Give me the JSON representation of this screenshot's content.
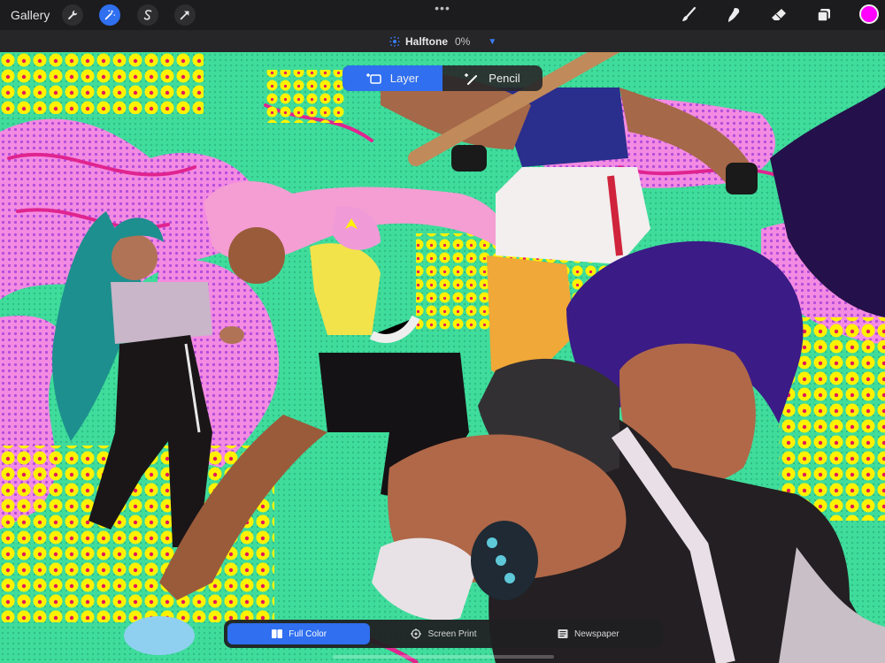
{
  "toolbar": {
    "gallery_label": "Gallery",
    "left_tools": [
      {
        "icon": "wrench-icon",
        "name": "actions"
      },
      {
        "icon": "magic-wand-icon",
        "name": "adjustments",
        "active": true
      },
      {
        "icon": "selection-s-icon",
        "name": "selection"
      },
      {
        "icon": "arrow-cursor-icon",
        "name": "transform"
      }
    ],
    "more_label": "•••",
    "right_tools": [
      {
        "icon": "brush-icon",
        "name": "brush"
      },
      {
        "icon": "smudge-icon",
        "name": "smudge"
      },
      {
        "icon": "eraser-icon",
        "name": "eraser"
      },
      {
        "icon": "layers-icon",
        "name": "layers"
      }
    ],
    "current_color": "#ff00ff"
  },
  "adjustment": {
    "name": "Halftone",
    "value": "0%"
  },
  "target_toggle": {
    "options": [
      {
        "label": "Layer",
        "icon": "layer-icon",
        "active": true
      },
      {
        "label": "Pencil",
        "icon": "pencil-icon",
        "active": false
      }
    ]
  },
  "mode_bar": {
    "options": [
      {
        "label": "Full Color",
        "icon": "book-icon",
        "active": true
      },
      {
        "label": "Screen Print",
        "icon": "crosshair-icon",
        "active": false
      },
      {
        "label": "Newspaper",
        "icon": "newspaper-icon",
        "active": false
      }
    ]
  },
  "colors": {
    "accent": "#2f6ff0",
    "toolbar_bg": "#1c1c1e",
    "artwork_background": "#3fdc9b",
    "halftone_dots": "#fff200"
  }
}
